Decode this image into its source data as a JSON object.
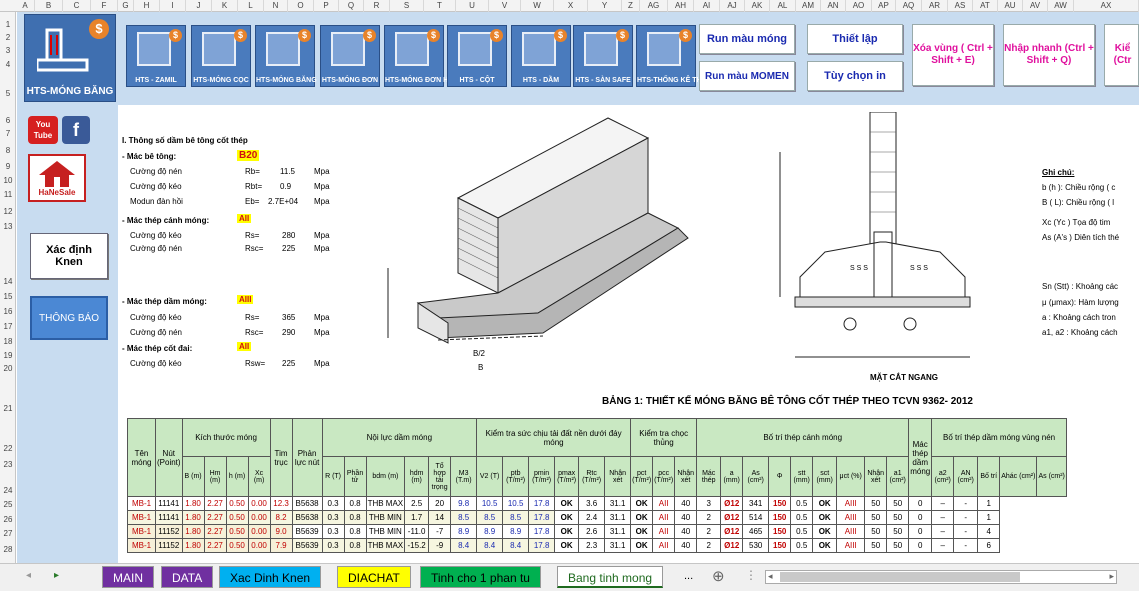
{
  "columns": [
    "A",
    "B",
    "C",
    "F",
    "G",
    "H",
    "I",
    "J",
    "K",
    "L",
    "N",
    "O",
    "P",
    "Q",
    "R",
    "S",
    "T",
    "U",
    "V",
    "W",
    "X",
    "Y",
    "Z",
    "AG",
    "AH",
    "AI",
    "AJ",
    "AK",
    "AL",
    "AM",
    "AN",
    "AO",
    "AP",
    "AQ",
    "AR",
    "AS",
    "AT",
    "AU",
    "AV",
    "AW",
    "AX"
  ],
  "rows": [
    "1",
    "2",
    "3",
    "4",
    "5",
    "6",
    "7",
    "8",
    "9",
    "10",
    "11",
    "12",
    "13",
    "14",
    "15",
    "16",
    "17",
    "18",
    "19",
    "20",
    "21",
    "22",
    "23",
    "24",
    "25",
    "26",
    "27",
    "28"
  ],
  "logo": {
    "label": "HTS-MÓNG BĂNG",
    "dollar": "$"
  },
  "tools": [
    "HTS - ZAMIL",
    "HTS-MÓNG CỌC",
    "HTS-MÓNG BĂNG",
    "HTS-MÓNG ĐƠN",
    "HTS-MÓNG ĐƠN HK",
    "HTS - CỘT",
    "HTS - DẦM",
    "HTS - SÀN SAFE",
    "HTS-THỐNG KÊ THÉP"
  ],
  "buttons": {
    "run_mong": "Run màu móng",
    "run_momen": "Run màu MOMEN",
    "thiet_lap": "Thiết lập",
    "tuy_chon": "Tùy chọn in",
    "xoa_vung": "Xóa vùng ( Ctrl + Shift + E)",
    "nhap_nhanh": "Nhập nhanh (Ctrl + Shift + Q)",
    "kie": "Kiể (Ctr"
  },
  "sidebar": {
    "youtube": "You Tube",
    "facebook": "f",
    "house": "HaNeSale",
    "xac_dinh": "Xác định Knen",
    "thong_bao": "THÔNG BÁO"
  },
  "params": {
    "sec_title": "I. Thông số dầm bê tông cốt thép",
    "mac_be_tong": "- Mác bê tông:",
    "b20": "B20",
    "cd_nen": "Cường độ nén",
    "rb": "Rb=",
    "rb_v": "11.5",
    "mpa": "Mpa",
    "cd_keo": "Cường độ kéo",
    "rbt": "Rbt=",
    "rbt_v": "0.9",
    "modun": "Modun đàn hồi",
    "eb": "Eb=",
    "eb_v": "2.7E+04",
    "mac_canh": "- Mác thép cánh móng:",
    "aii": "AII",
    "cd_keo2": "Cường độ kéo",
    "rs": "Rs=",
    "rs_v": "280",
    "cd_nen2": "Cường độ nén",
    "rsc": "Rsc=",
    "rsc_v": "225",
    "mac_dam": "- Mác thép dầm móng:",
    "aiii": "AIII",
    "cd_keo3": "Cường độ kéo",
    "rs3": "Rs=",
    "rs3_v": "365",
    "cd_nen3": "Cường độ nén",
    "rsc3": "Rsc=",
    "rsc3_v": "290",
    "mac_dai": "- Mác thép cốt đai:",
    "aii2": "AII",
    "cd_keo4": "Cường độ kéo",
    "rsw": "Rsw=",
    "rsw_v": "225"
  },
  "notes": {
    "ghi_chu": "Ghi chú:",
    "n1": "b (h ): Chiều rộng ( c",
    "n2": "B ( L): Chiều rộng ( l",
    "n3": "Xc (Yc ) Tọa độ tim",
    "n4": "As (A's ) Diên tích thé",
    "n5": "Sn (Stt) : Khoảng các",
    "n6": "μ (μmax): Hàm lượng",
    "n7": "a : Khoảng cách tron",
    "n8": "a1, a2 : Khoảng cách",
    "mat_cat": "MẶT CẮT NGANG"
  },
  "table_title": "BẢNG 1: THIẾT KẾ MÓNG BĂNG BÊ TÔNG CỐT THÉP THEO TCVN 9362- 2012",
  "table": {
    "h1": [
      "Tên móng",
      "Nút (Point)",
      "Kích thước móng",
      "Tim trục",
      "Phản lực nút",
      "Nội lực dầm móng",
      "Kiểm tra sức chịu tải đất nền dưới đáy móng",
      "Kiểm tra chọc thủng",
      "Bố trí thép cánh móng",
      "Mác thép dầm móng",
      "Bố trí thép dầm móng vùng nén"
    ],
    "h2": [
      "B (m)",
      "Hm (m)",
      "h (m)",
      "Xc (m)",
      "R (T)",
      "Phần tử",
      "bdm (m)",
      "hdm (m)",
      "Tổ hợp tải trọng",
      "M3 (T.m)",
      "V2 (T)",
      "ptb (T/m²)",
      "pmin (T/m²)",
      "pmax (T/m²)",
      "Rtc (T/m²)",
      "Nhận xét",
      "pct (T/m²)",
      "pcc (T/m²)",
      "Nhận xét",
      "Mác thép",
      "a (mm)",
      "As (cm²)",
      "Φ",
      "stt (mm)",
      "sct (mm)",
      "μct (%)",
      "Nhận xét",
      "a1 (cm²)",
      "a2 (cm²)",
      "AN (cm²)",
      "Bố trí",
      "Ahác (cm²)",
      "As (cm²)"
    ],
    "rows": [
      [
        "MB-1",
        "11141",
        "1.80",
        "2.27",
        "0.50",
        "0.00",
        "12.3",
        "B5638",
        "0.3",
        "0.8",
        "THB MAX",
        "2.5",
        "20",
        "9.8",
        "10.5",
        "10.5",
        "17.8",
        "OK",
        "3.6",
        "31.1",
        "OK",
        "AII",
        "40",
        "3",
        "Ø12",
        "341",
        "150",
        "0.5",
        "OK",
        "AIII",
        "50",
        "50",
        "0",
        "–",
        "-",
        "1"
      ],
      [
        "MB-1",
        "11141",
        "1.80",
        "2.27",
        "0.50",
        "0.00",
        "8.2",
        "B5638",
        "0.3",
        "0.8",
        "THB MIN",
        "1.7",
        "14",
        "8.5",
        "8.5",
        "8.5",
        "17.8",
        "OK",
        "2.4",
        "31.1",
        "OK",
        "AII",
        "40",
        "2",
        "Ø12",
        "514",
        "150",
        "0.5",
        "OK",
        "AIII",
        "50",
        "50",
        "0",
        "–",
        "-",
        "1"
      ],
      [
        "MB-1",
        "11152",
        "1.80",
        "2.27",
        "0.50",
        "0.00",
        "9.0",
        "B5639",
        "0.3",
        "0.8",
        "THB MIN",
        "-11.0",
        "-7",
        "8.9",
        "8.9",
        "8.9",
        "17.8",
        "OK",
        "2.6",
        "31.1",
        "OK",
        "AII",
        "40",
        "2",
        "Ø12",
        "465",
        "150",
        "0.5",
        "OK",
        "AIII",
        "50",
        "50",
        "0",
        "–",
        "-",
        "4"
      ],
      [
        "MB-1",
        "11152",
        "1.80",
        "2.27",
        "0.50",
        "0.00",
        "7.9",
        "B5639",
        "0.3",
        "0.8",
        "THB MAX",
        "-15.2",
        "-9",
        "8.4",
        "8.4",
        "8.4",
        "17.8",
        "OK",
        "2.3",
        "31.1",
        "OK",
        "AII",
        "40",
        "2",
        "Ø12",
        "530",
        "150",
        "0.5",
        "OK",
        "AIII",
        "50",
        "50",
        "0",
        "–",
        "-",
        "6"
      ]
    ]
  },
  "tabs": [
    "MAIN",
    "DATA",
    "Xac Dinh Kknen",
    "DIACHAT",
    "Tinh cho 1 phan tu",
    "Bang tinh mong",
    "..."
  ],
  "tab_labels": {
    "main": "MAIN",
    "data": "DATA",
    "xac": "Xac Dinh Knen",
    "diachat": "DIACHAT",
    "tinh": "Tinh cho 1 phan tu",
    "bang": "Bang tinh mong",
    "more": "...",
    "add": "⊕"
  }
}
